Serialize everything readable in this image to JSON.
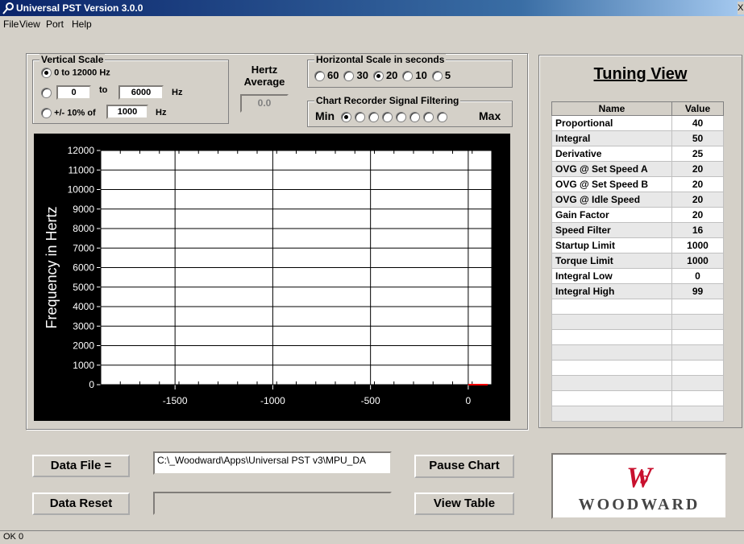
{
  "window": {
    "title": "Universal PST Version 3.0.0",
    "close_glyph": "X"
  },
  "menu": [
    "File",
    "View",
    "Port",
    "Help"
  ],
  "vertical_scale": {
    "legend": "Vertical Scale",
    "option1": "0 to 12000 Hz",
    "low_value": "0",
    "to_label": "to",
    "high_value": "6000",
    "hz1": "Hz",
    "pct_label": "+/- 10% of",
    "pct_value": "1000",
    "hz2": "Hz"
  },
  "hertz_avg": {
    "label1": "Hertz",
    "label2": "Average",
    "value": "0.0"
  },
  "horizontal_scale": {
    "legend": "Horizontal Scale in seconds",
    "options": [
      "60",
      "30",
      "20",
      "10",
      "5"
    ],
    "selected": "20"
  },
  "filtering": {
    "legend": "Chart Recorder Signal Filtering",
    "min_label": "Min",
    "max_label": "Max",
    "count": 8,
    "selected_index": 0
  },
  "tuning": {
    "title": "Tuning View",
    "col_name": "Name",
    "col_value": "Value",
    "rows": [
      [
        "Proportional",
        "40"
      ],
      [
        "Integral",
        "50"
      ],
      [
        "Derivative",
        "25"
      ],
      [
        "OVG @ Set Speed A",
        "20"
      ],
      [
        "OVG @ Set Speed B",
        "20"
      ],
      [
        "OVG @ Idle Speed",
        "20"
      ],
      [
        "Gain Factor",
        "20"
      ],
      [
        "Speed Filter",
        "16"
      ],
      [
        "Startup Limit",
        "1000"
      ],
      [
        "Torque Limit",
        "1000"
      ],
      [
        "Integral Low",
        "0"
      ],
      [
        "Integral High",
        "99"
      ],
      [
        "",
        ""
      ],
      [
        "",
        ""
      ],
      [
        "",
        ""
      ],
      [
        "",
        ""
      ],
      [
        "",
        ""
      ],
      [
        "",
        ""
      ],
      [
        "",
        ""
      ],
      [
        "",
        ""
      ]
    ]
  },
  "chart_data": {
    "type": "line",
    "ylabel": "Frequency in Hertz",
    "yticks": [
      "0",
      "1000",
      "2000",
      "3000",
      "4000",
      "5000",
      "6000",
      "7000",
      "8000",
      "9000",
      "10000",
      "11000",
      "12000"
    ],
    "xticks": [
      "-1500",
      "-1000",
      "-500",
      "0"
    ],
    "xtick_values": [
      -1500,
      -1000,
      -500,
      0
    ],
    "xlim": [
      -1880,
      120
    ],
    "ylim": [
      0,
      12000
    ],
    "grid": true,
    "series": [
      {
        "x": [
          0,
          100
        ],
        "y": [
          0,
          0
        ],
        "color": "#ff0000"
      }
    ]
  },
  "bottom": {
    "data_file_label": "Data File =",
    "data_file_path": "C:\\_Woodward\\Apps\\Universal PST v3\\MPU_DA",
    "pause_label": "Pause Chart",
    "reset_label": "Data Reset",
    "reset_field": "",
    "view_table_label": "View Table",
    "logo_text": "WOODWARD"
  },
  "status": {
    "text": "OK 0"
  },
  "colors": {
    "logo_red": "#c8102e",
    "title_blue": "#0a246a"
  }
}
